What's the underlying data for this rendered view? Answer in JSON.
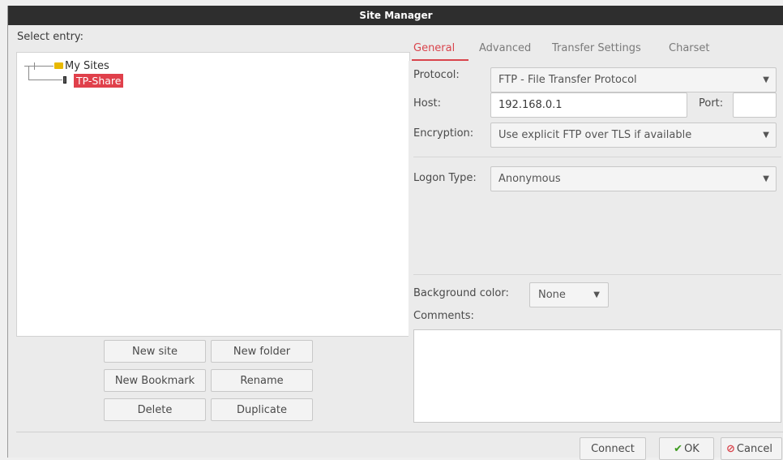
{
  "window": {
    "title": "Site Manager"
  },
  "tree": {
    "label": "Select entry:",
    "root": {
      "label": "My Sites",
      "icon": "folder-icon"
    },
    "site": {
      "label": "TP-Share",
      "icon": "server-icon",
      "selected": true
    }
  },
  "left_buttons": {
    "new_site": "New site",
    "new_folder": "New folder",
    "new_bookmark": "New Bookmark",
    "rename": "Rename",
    "delete": "Delete",
    "duplicate": "Duplicate"
  },
  "tabs": [
    {
      "label": "General",
      "active": true
    },
    {
      "label": "Advanced",
      "active": false
    },
    {
      "label": "Transfer Settings",
      "active": false
    },
    {
      "label": "Charset",
      "active": false
    }
  ],
  "general": {
    "protocol_label": "Protocol:",
    "protocol_value": "FTP - File Transfer Protocol",
    "host_label": "Host:",
    "host_value": "192.168.0.1",
    "port_label": "Port:",
    "port_value": "",
    "encryption_label": "Encryption:",
    "encryption_value": "Use explicit FTP over TLS if available",
    "logon_label": "Logon Type:",
    "logon_value": "Anonymous",
    "bgcolor_label": "Background color:",
    "bgcolor_value": "None",
    "comments_label": "Comments:"
  },
  "footer": {
    "connect": "Connect",
    "ok": "OK",
    "cancel": "Cancel"
  },
  "colors": {
    "accent": "#d9444c",
    "ok_check": "#3c9a1e",
    "folder": "#e8b800"
  }
}
